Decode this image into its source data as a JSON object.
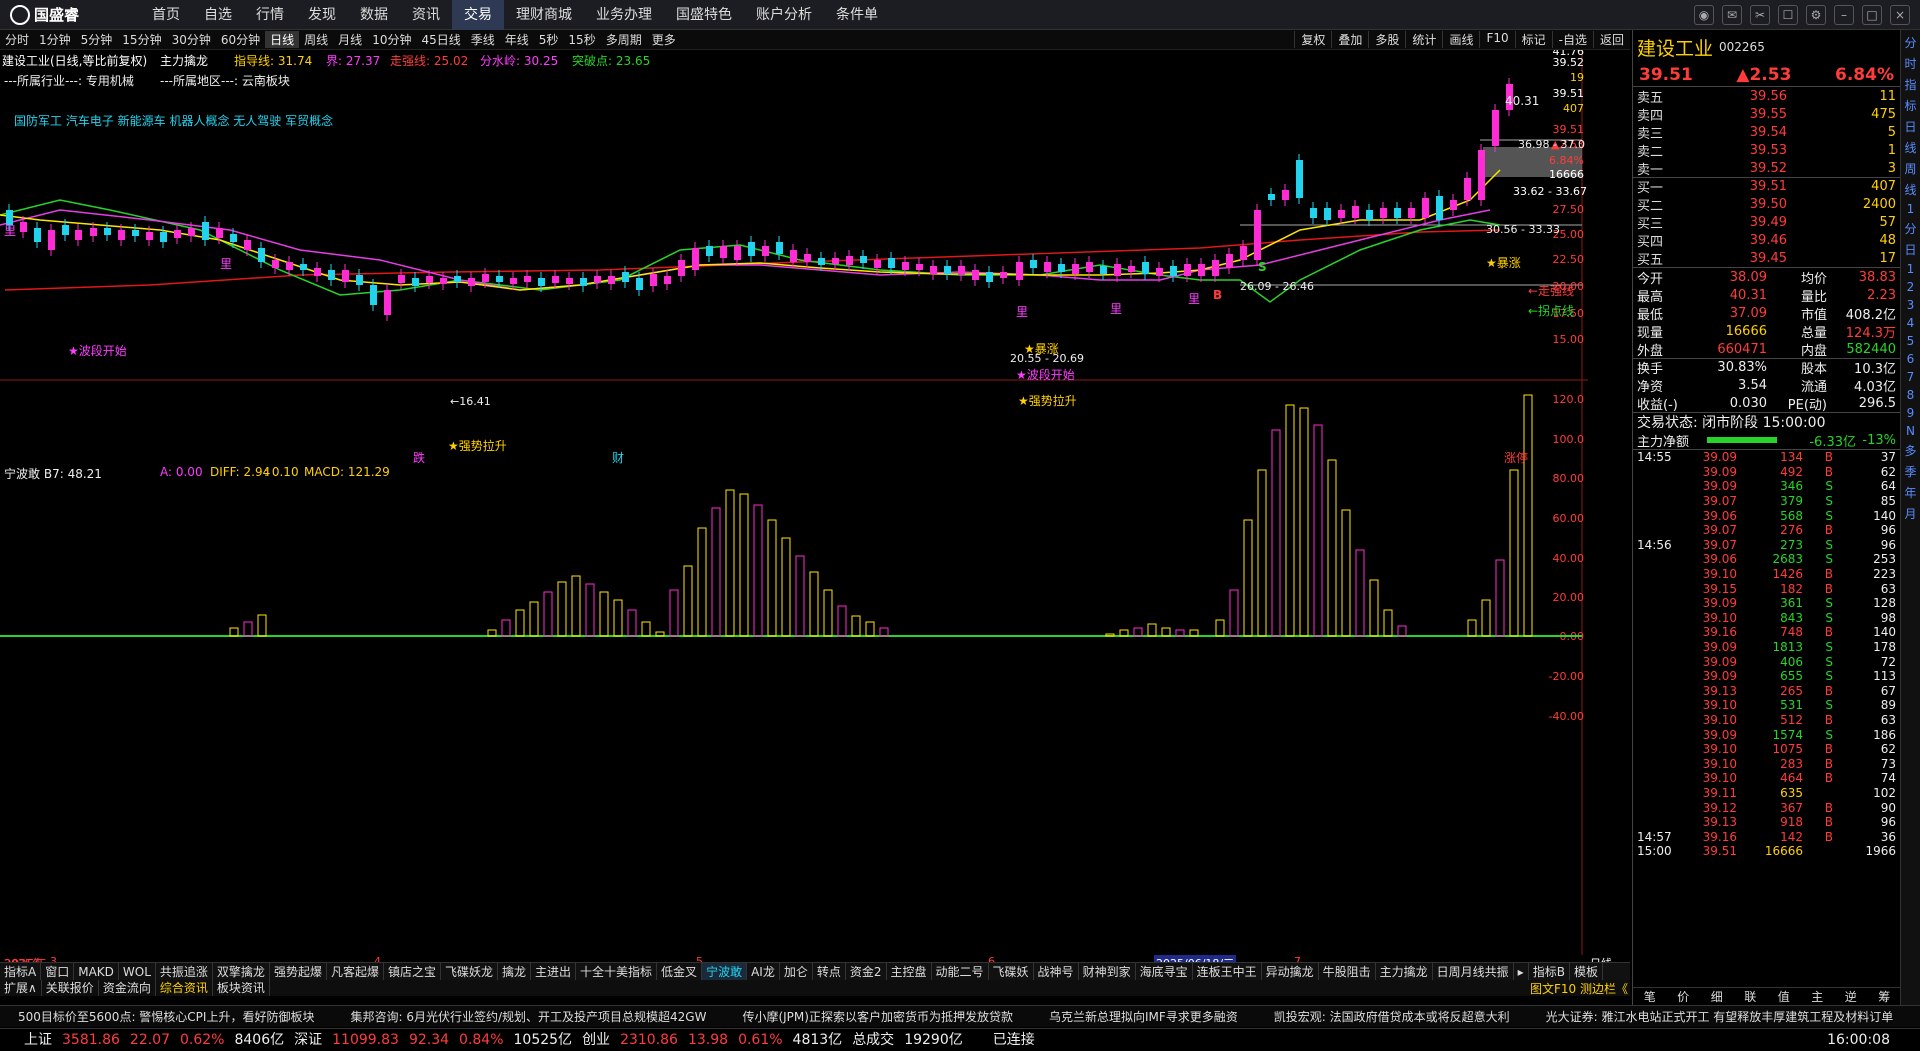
{
  "app": {
    "name": "国盛睿"
  },
  "menu": [
    "首页",
    "自选",
    "行情",
    "发现",
    "数据",
    "资讯",
    "交易",
    "理财商城",
    "业务办理",
    "国盛特色",
    "账户分析",
    "条件单"
  ],
  "menu_active": 6,
  "periods": [
    "分时",
    "1分钟",
    "5分钟",
    "15分钟",
    "30分钟",
    "60分钟",
    "日线",
    "周线",
    "月线",
    "10分钟",
    "45日线",
    "季线",
    "年线",
    "5秒",
    "15秒",
    "多周期",
    "更多"
  ],
  "period_active": 6,
  "tools": [
    "复权",
    "叠加",
    "多股",
    "统计",
    "画线",
    "F10",
    "标记",
    "-自选",
    "返回"
  ],
  "stock": {
    "name": "建设工业",
    "code": "002265",
    "header": "建设工业(日线,等比前复权)",
    "indicator": "主力擒龙",
    "guideline_lbl": "指导线: 31.74",
    "jie_lbl": "界: 27.37",
    "strong_lbl": "走强线: 25.02",
    "watershed_lbl": "分水岭: 30.25",
    "break_lbl": "突破点: 23.65",
    "industry": "---所属行业---: 专用机械",
    "region": "---所属地区---: 云南板块",
    "concepts": "国防军工 汽车电子 新能源车 机器人概念 无人驾驶 军贸概念"
  },
  "chart_labels": {
    "lbl_4041": "40.31",
    "lbl_3698": "36.98 - 37.0",
    "lbl_3362": "33.62 - 33.67",
    "lbl_3056": "30.56 - 33.33",
    "lbl_2609": "26.09 - 26.46",
    "lbl_2055": "20.55 - 20.69",
    "lbl_1641": "←16.41",
    "weak": "←走强线",
    "guai": "←拐点线",
    "bodong1": "★波段开始",
    "bodong2": "★波段开始",
    "qiangshi1": "★强势拉升",
    "qiangshi2": "★强势拉升",
    "zhang1": "★暴涨",
    "zhang2": "★暴涨",
    "li": "里",
    "die": "跌",
    "cai": "财",
    "zhangting": "涨停",
    "S": "S",
    "B": "B"
  },
  "yaxis_top": [
    "41.76",
    "39.52",
    "19",
    "39.51",
    "407",
    "39.51",
    "▲2.53",
    "6.84%",
    "16666",
    "27.50",
    "25.00",
    "22.50",
    "20.00",
    "17.50",
    "15.00"
  ],
  "macd": {
    "name": "宁波敢",
    "b7": "B7: 48.21",
    "a": "A: 0.00",
    "diff": "DIFF: 2.94",
    "v": ": 0.10",
    "macd": "MACD: 121.29"
  },
  "yaxis_macd": [
    "120.0",
    "100.0",
    "80.00",
    "60.00",
    "40.00",
    "20.00",
    "0.00",
    "-20.00",
    "-40.00"
  ],
  "xaxis": {
    "y2025": "2025年",
    "m3": "3",
    "m4": "4",
    "m5": "5",
    "m6": "6",
    "date": "2025/06/18/三",
    "m7": "7",
    "period": "日线"
  },
  "quote": {
    "price": "39.51",
    "change": "▲2.53",
    "pct": "6.84%"
  },
  "book": [
    [
      "卖五",
      "39.56",
      "11"
    ],
    [
      "卖四",
      "39.55",
      "475"
    ],
    [
      "卖三",
      "39.54",
      "5"
    ],
    [
      "卖二",
      "39.53",
      "1"
    ],
    [
      "卖一",
      "39.52",
      "3"
    ],
    [
      "买一",
      "39.51",
      "407"
    ],
    [
      "买二",
      "39.50",
      "2400"
    ],
    [
      "买三",
      "39.49",
      "57"
    ],
    [
      "买四",
      "39.46",
      "48"
    ],
    [
      "买五",
      "39.45",
      "17"
    ]
  ],
  "stats": [
    [
      "今开",
      "38.09",
      "均价",
      "38.83"
    ],
    [
      "最高",
      "40.31",
      "量比",
      "2.23"
    ],
    [
      "最低",
      "37.09",
      "市值",
      "408.2亿"
    ],
    [
      "现量",
      "16666",
      "总量",
      "124.3万"
    ],
    [
      "外盘",
      "660471",
      "内盘",
      "582440"
    ],
    [
      "换手",
      "30.83%",
      "股本",
      "10.3亿"
    ],
    [
      "净资",
      "3.54",
      "流通",
      "4.03亿"
    ],
    [
      "收益(-)",
      "0.030",
      "PE(动)",
      "296.5"
    ]
  ],
  "trade_state": "交易状态: 闭市阶段 15:00:00",
  "main_net": {
    "label": "主力净额",
    "value": "-6.33亿",
    "pct": "-13%"
  },
  "ticks": [
    [
      "14:55",
      "39.09",
      "134",
      "B",
      "37"
    ],
    [
      "",
      "39.09",
      "492",
      "B",
      "62"
    ],
    [
      "",
      "39.09",
      "346",
      "S",
      "64"
    ],
    [
      "",
      "39.07",
      "379",
      "S",
      "85"
    ],
    [
      "",
      "39.06",
      "568",
      "S",
      "140"
    ],
    [
      "",
      "39.07",
      "276",
      "B",
      "96"
    ],
    [
      "14:56",
      "39.07",
      "273",
      "S",
      "96"
    ],
    [
      "",
      "39.06",
      "2683",
      "S",
      "253"
    ],
    [
      "",
      "39.10",
      "1426",
      "B",
      "223"
    ],
    [
      "",
      "39.15",
      "182",
      "B",
      "63"
    ],
    [
      "",
      "39.09",
      "361",
      "S",
      "128"
    ],
    [
      "",
      "39.10",
      "843",
      "S",
      "98"
    ],
    [
      "",
      "39.16",
      "748",
      "B",
      "140"
    ],
    [
      "",
      "39.09",
      "1813",
      "S",
      "178"
    ],
    [
      "",
      "39.09",
      "406",
      "S",
      "72"
    ],
    [
      "",
      "39.09",
      "655",
      "S",
      "113"
    ],
    [
      "",
      "39.13",
      "265",
      "B",
      "67"
    ],
    [
      "",
      "39.10",
      "531",
      "S",
      "89"
    ],
    [
      "",
      "39.10",
      "512",
      "B",
      "63"
    ],
    [
      "",
      "39.09",
      "1574",
      "S",
      "186"
    ],
    [
      "",
      "39.10",
      "1075",
      "B",
      "62"
    ],
    [
      "",
      "39.10",
      "283",
      "B",
      "73"
    ],
    [
      "",
      "39.10",
      "464",
      "B",
      "74"
    ],
    [
      "",
      "39.11",
      "635",
      "",
      "102"
    ],
    [
      "",
      "39.12",
      "367",
      "B",
      "90"
    ],
    [
      "",
      "39.13",
      "918",
      "B",
      "96"
    ],
    [
      "14:57",
      "39.16",
      "142",
      "B",
      "36"
    ],
    [
      "15:00",
      "39.51",
      "16666",
      "",
      "1966"
    ]
  ],
  "sidebar": [
    "分",
    "时",
    "指",
    "标",
    "日",
    "线",
    "周",
    "线",
    "1",
    "分",
    "日",
    "1",
    "2",
    "3",
    "4",
    "5",
    "6",
    "7",
    "8",
    "9",
    "N",
    "多",
    "季",
    "年",
    "月"
  ],
  "tabs1": [
    "指标A",
    "窗口",
    "MAKD",
    "WOL",
    "共振追涨",
    "双擎擒龙",
    "强势起爆",
    "凡客起爆",
    "镇店之宝",
    "飞碟妖龙",
    "擒龙",
    "主进出",
    "十全十美指标",
    "低金叉",
    "宁波敢",
    "AI龙",
    "加仑",
    "转点",
    "资金2",
    "主控盘",
    "动能二号",
    "飞碟妖",
    "战神号",
    "财神到家",
    "海底寻宝",
    "连板王中王",
    "异动擒龙",
    "牛股阻击",
    "主力擒龙",
    "日周月线共振",
    "▸",
    "指标B",
    "模板"
  ],
  "tabs1_active": 14,
  "tabs2": [
    "扩展∧",
    "关联报价",
    "资金流向",
    "综合资讯",
    "板块资讯"
  ],
  "tabs2_active": 3,
  "rp_tabs": [
    "笔",
    "价",
    "细",
    "联",
    "值",
    "主",
    "逆",
    "筹"
  ],
  "tabs2_right": "图文F10  测边栏《",
  "news": [
    "500目标价至5600点: 警惕核心CPI上升，看好防御板块",
    "集邦咨询: 6月光伏行业签约/规划、开工及投产项目总规模超42GW",
    "传小摩(JPM)正探索以客户加密货币为抵押发放贷款",
    "乌克兰新总理拟向IMF寻求更多融资",
    "凯投宏观: 法国政府借贷成本或将反超意大利",
    "光大证券: 雅江水电站正式开工 有望释放丰厚建筑工程及材料订单"
  ],
  "status": {
    "sh": "上证",
    "sh_v": "3581.86",
    "sh_c": "22.07",
    "sh_p": "0.62%",
    "sh_amt": "8406亿",
    "sz": "深证",
    "sz_v": "11099.83",
    "sz_c": "92.34",
    "sz_p": "0.84%",
    "sz_amt": "10525亿",
    "cy": "创业",
    "cy_v": "2310.86",
    "cy_c": "13.98",
    "cy_p": "0.61%",
    "cy_amt": "4813亿",
    "total": "总成交",
    "total_v": "19290亿",
    "conn": "已连接",
    "time": "16:00:08"
  }
}
